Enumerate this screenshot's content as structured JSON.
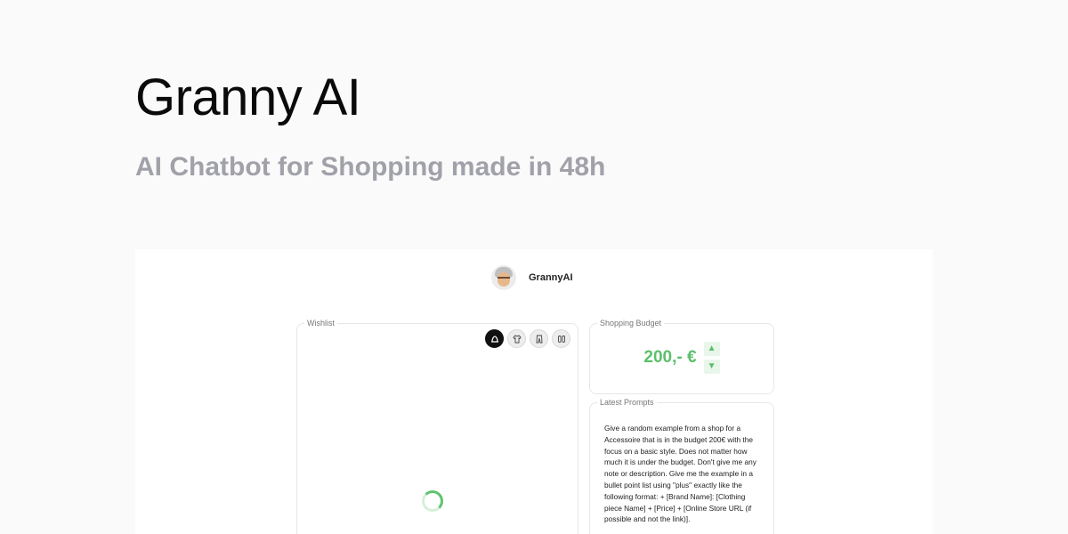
{
  "page": {
    "title": "Granny AI",
    "subtitle": "AI Chatbot for Shopping made in 48h"
  },
  "app": {
    "name": "GrannyAI"
  },
  "wishlist": {
    "legend": "Wishlist",
    "categories": [
      {
        "icon": "hat-icon",
        "active": true
      },
      {
        "icon": "tshirt-icon",
        "active": false
      },
      {
        "icon": "pants-icon",
        "active": false
      },
      {
        "icon": "shoes-icon",
        "active": false
      }
    ]
  },
  "budget": {
    "legend": "Shopping Budget",
    "value": "200,- €",
    "up_icon": "▲",
    "down_icon": "▼"
  },
  "prompts": {
    "legend": "Latest Prompts",
    "text": "Give a random example from a shop for a Accessoire that is in the budget 200€ with the focus on a basic style. Does not matter how much it is under the budget. Don't give me any note or description. Give me the example in a bullet point list using \"plus\" exactly like the following format: + [Brand Name]: [Clothing piece Name] + [Price] + [Online Store URL (if possible and not the link)]."
  },
  "colors": {
    "accent_green": "#5cbf6a",
    "subtitle_gray": "#a1a1aa"
  }
}
